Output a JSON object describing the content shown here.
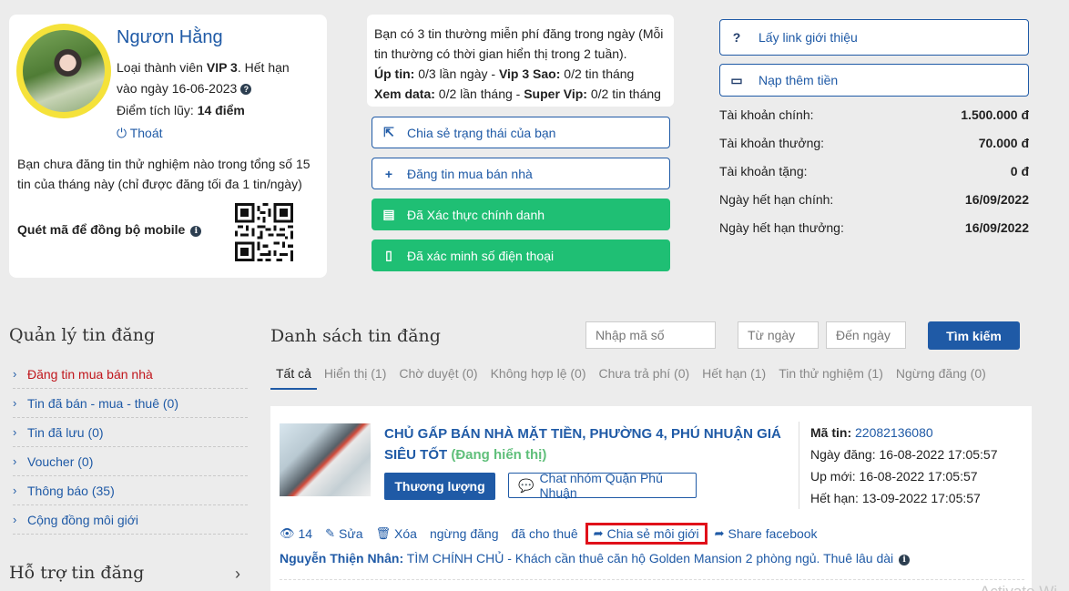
{
  "profile": {
    "name": "Ngươn Hằng",
    "member_prefix": "Loại thành viên ",
    "member_level": "VIP 3",
    "member_suffix": ". Hết hạn vào ngày 16-06-2023",
    "points_prefix": "Điểm tích lũy: ",
    "points_value": "14 điểm",
    "logout": "Thoát",
    "trial_note": "Bạn chưa đăng tin thử nghiệm nào trong tổng số 15 tin của tháng này (chỉ được đăng tối đa 1 tin/ngày)",
    "qr_label": "Quét mã để đồng bộ mobile"
  },
  "quota": {
    "line1": "Bạn có 3 tin thường miễn phí đăng trong ngày (Mỗi tin thường có thời gian hiển thị trong 2 tuần).",
    "up_label": "Úp tin:",
    "up_value": " 0/3 lần ngày - ",
    "vip3_label": "Vip 3 Sao:",
    "vip3_value": " 0/2 tin tháng",
    "data_label": "Xem data:",
    "data_value": " 0/2 lần tháng - ",
    "supervip_label": "Super Vip:",
    "supervip_value": " 0/2 tin tháng"
  },
  "actions_mid": [
    {
      "label": "Chia sẻ trạng thái của bạn",
      "icon": "share-square-icon"
    },
    {
      "label": "Đăng tin mua bán nhà",
      "icon": "plus-icon"
    },
    {
      "label": "Đã Xác thực chính danh",
      "icon": "id-card-icon"
    },
    {
      "label": "Đã xác minh số điện thoại",
      "icon": "phone-icon"
    }
  ],
  "account": {
    "referral_button": "Lấy link giới thiệu",
    "topup_button": "Nạp thêm tiền",
    "rows": [
      {
        "label": "Tài khoản chính:",
        "value": "1.500.000 đ"
      },
      {
        "label": "Tài khoản thưởng:",
        "value": "70.000 đ"
      },
      {
        "label": "Tài khoản tặng:",
        "value": "0 đ"
      },
      {
        "label": "Ngày hết hạn chính:",
        "value": "16/09/2022"
      },
      {
        "label": "Ngày hết hạn thưởng:",
        "value": "16/09/2022"
      }
    ]
  },
  "sidebar": {
    "title": "Quản lý tin đăng",
    "items": [
      {
        "label": "Đăng tin mua bán nhà"
      },
      {
        "label": "Tin đã bán - mua - thuê (0)"
      },
      {
        "label": "Tin đã lưu (0)"
      },
      {
        "label": "Voucher (0)"
      },
      {
        "label": "Thông báo (35)"
      },
      {
        "label": "Cộng đồng môi giới"
      }
    ],
    "support_title": "Hỗ trợ tin đăng"
  },
  "listing_panel": {
    "title": "Danh sách tin đăng",
    "code_placeholder": "Nhập mã số",
    "from_placeholder": "Từ ngày",
    "to_placeholder": "Đến ngày",
    "search_button": "Tìm kiếm",
    "tabs": [
      "Tất cả",
      "Hiển thị (1)",
      "Chờ duyệt (0)",
      "Không hợp lệ (0)",
      "Chưa trả phí (0)",
      "Hết hạn (1)",
      "Tin thử nghiệm (1)",
      "Ngừng đăng (0)"
    ]
  },
  "listing": {
    "title": "CHỦ GẤP BÁN NHÀ MẶT TIỀN, PHƯỜNG 4, PHÚ NHUẬN GIÁ SIÊU TỐT",
    "status": "(Đang hiển thị)",
    "price_button": "Thương lượng",
    "chat_button": "Chat nhóm Quận Phú Nhuận",
    "code_label": "Mã tin:",
    "code_value": "22082136080",
    "posted_label": "Ngày đăng:",
    "posted_value": "16-08-2022 17:05:57",
    "updated_label": "Up mới:",
    "updated_value": "16-08-2022 17:05:57",
    "expires_label": "Hết hạn:",
    "expires_value": "13-09-2022 17:05:57",
    "views": "14",
    "edit": "Sửa",
    "delete": "Xóa",
    "stop": "ngừng đăng",
    "rented": "đã cho thuê",
    "share_broker": "Chia sẻ môi giới",
    "share_facebook": "Share facebook",
    "note_author": "Nguyễn Thiện Nhân:",
    "note_text": " TÌM CHÍNH CHỦ - Khách cần thuê căn hộ Golden Mansion 2 phòng ngủ. Thuê lâu dài"
  },
  "watermark": "Activate Wi",
  "colors": {
    "primary": "#1f5aa6",
    "success": "#1fbf74",
    "danger": "#e0101a",
    "avatar_ring": "#f5e23a"
  }
}
